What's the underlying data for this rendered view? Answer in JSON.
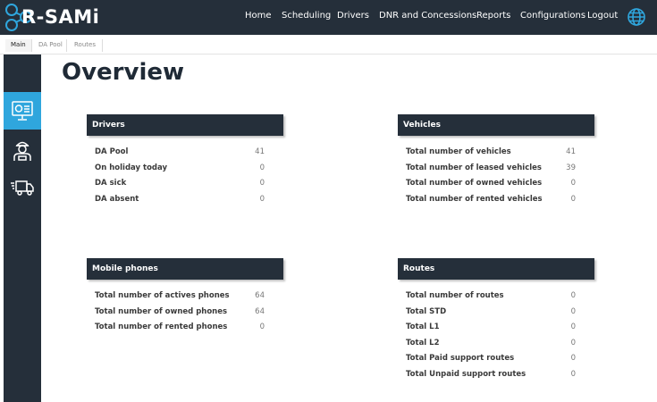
{
  "app": {
    "logo_text": "R-SAMi",
    "colors": {
      "topbar": "#252f3a",
      "accent": "#2fa6dd",
      "panel_header": "#252f3a"
    }
  },
  "nav": {
    "items": [
      "Home",
      "Scheduling",
      "Drivers",
      "DNR and Concessions",
      "Reports",
      "Configurations",
      "Logout"
    ],
    "globe_icon": "globe-icon"
  },
  "tabs": [
    "Main",
    "DA Pool",
    "Routes"
  ],
  "sidebar": {
    "items": [
      {
        "icon": "dashboard-monitor-icon",
        "active": true
      },
      {
        "icon": "driver-person-icon",
        "active": false
      },
      {
        "icon": "delivery-truck-icon",
        "active": false
      }
    ]
  },
  "page": {
    "title": "Overview"
  },
  "panels": {
    "drivers": {
      "title": "Drivers",
      "rows": [
        {
          "label": "DA Pool",
          "value": "41"
        },
        {
          "label": "On holiday today",
          "value": "0"
        },
        {
          "label": "DA sick",
          "value": "0"
        },
        {
          "label": "DA absent",
          "value": "0"
        }
      ]
    },
    "vehicles": {
      "title": "Vehicles",
      "rows": [
        {
          "label": "Total number of vehicles",
          "value": "41"
        },
        {
          "label": "Total number of leased vehicles",
          "value": "39"
        },
        {
          "label": "Total number of owned vehicles",
          "value": "0"
        },
        {
          "label": "Total number of rented vehicles",
          "value": "0"
        }
      ]
    },
    "phones": {
      "title": "Mobile phones",
      "rows": [
        {
          "label": "Total number of actives phones",
          "value": "64"
        },
        {
          "label": "Total number of owned phones",
          "value": "64"
        },
        {
          "label": "Total number of rented phones",
          "value": "0"
        }
      ]
    },
    "routes": {
      "title": "Routes",
      "rows": [
        {
          "label": "Total number of routes",
          "value": "0"
        },
        {
          "label": "Total STD",
          "value": "0"
        },
        {
          "label": "Total L1",
          "value": "0"
        },
        {
          "label": "Total L2",
          "value": "0"
        },
        {
          "label": "Total Paid support routes",
          "value": "0"
        },
        {
          "label": "Total Unpaid support routes",
          "value": "0"
        }
      ]
    }
  }
}
